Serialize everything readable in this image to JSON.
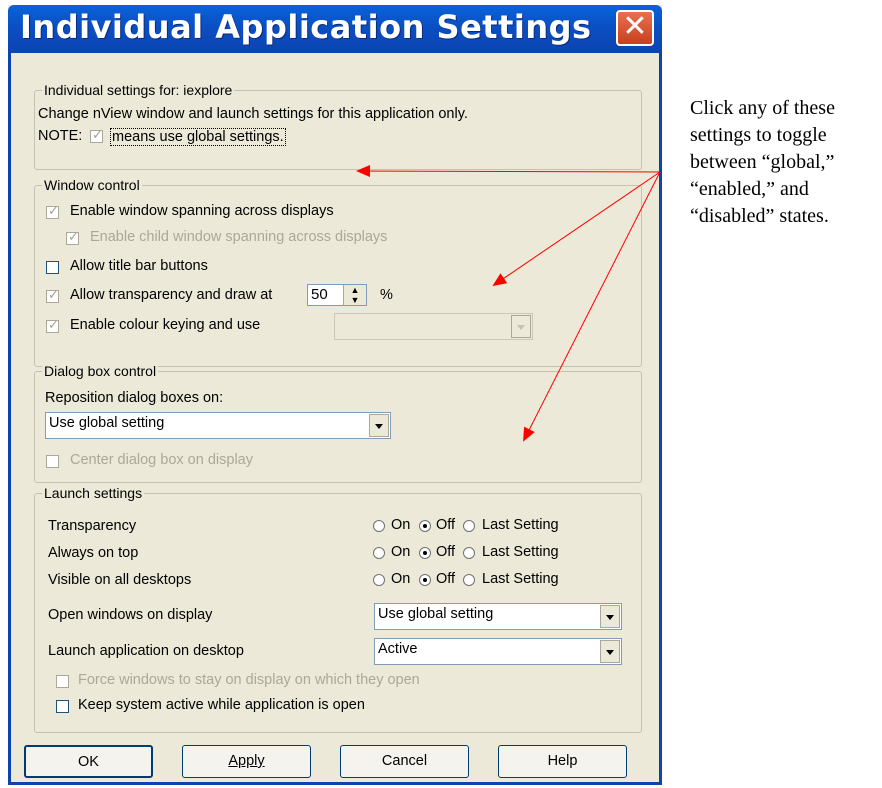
{
  "window": {
    "title": "Individual Application Settings",
    "close_glyph": "✕"
  },
  "individual": {
    "legend": "Individual settings for: iexplore",
    "line1": "Change nView window and launch settings for this application only.",
    "note_prefix": "NOTE:",
    "note_text": "means use global settings."
  },
  "window_control": {
    "legend": "Window control",
    "spanning": "Enable window spanning across displays",
    "child_spanning": "Enable child window spanning across displays",
    "title_bar": "Allow title bar buttons",
    "transparency": "Allow transparency and draw at",
    "transparency_value": "50",
    "percent": "%",
    "colour_keying": "Enable colour keying and use"
  },
  "dialog_control": {
    "legend": "Dialog box control",
    "reposition_label": "Reposition dialog boxes on:",
    "reposition_value": "Use global setting",
    "center": "Center dialog box on display"
  },
  "launch": {
    "legend": "Launch settings",
    "rows": [
      {
        "label": "Transparency",
        "selected": "Off"
      },
      {
        "label": "Always on top",
        "selected": "Off"
      },
      {
        "label": "Visible on all desktops",
        "selected": "Off"
      }
    ],
    "opt_on": "On",
    "opt_off": "Off",
    "opt_last": "Last Setting",
    "open_windows_label": "Open windows on display",
    "open_windows_value": "Use global setting",
    "launch_desktop_label": "Launch application on desktop",
    "launch_desktop_value": "Active",
    "force_windows": "Force windows to stay on display on which they open",
    "keep_active": "Keep system active while application is open"
  },
  "buttons": {
    "ok": "OK",
    "apply": "Apply",
    "cancel": "Cancel",
    "help": "Help"
  },
  "annotation": {
    "text": "Click any of these settings to toggle between “global,” “enabled,” and “disabled” states.",
    "arrow_color": "#ff0000"
  }
}
